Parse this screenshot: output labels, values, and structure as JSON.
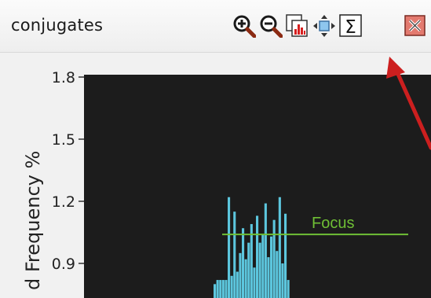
{
  "window": {
    "title": "conjugates"
  },
  "toolbar": {
    "buttons": [
      {
        "icon": "zoom-in-icon"
      },
      {
        "icon": "zoom-out-icon"
      },
      {
        "icon": "histogram-chart-icon"
      },
      {
        "icon": "pan-icon"
      },
      {
        "icon": "sum-icon"
      },
      {
        "icon": "close-icon"
      }
    ],
    "sum_symbol": "Σ"
  },
  "annotation": {
    "arrow_color": "#cc1f1f"
  },
  "chart_data": {
    "type": "bar",
    "ylabel": "d Frequency %",
    "yticks": [
      0.9,
      1.2,
      1.5,
      1.8
    ],
    "ytick_labels": [
      "0.9",
      "1.2",
      "1.5",
      "1.8"
    ],
    "ylim": [
      0.78,
      1.82
    ],
    "background": "#1c1c1c",
    "bar_color": "#5cc6dd",
    "focus": {
      "label": "Focus",
      "value": 1.04,
      "color": "#6fbf35"
    },
    "bars": [
      {
        "v": 0.8
      },
      {
        "v": 0.82
      },
      {
        "v": 0.82
      },
      {
        "v": 0.82
      },
      {
        "v": 0.82
      },
      {
        "v": 1.22
      },
      {
        "v": 0.84
      },
      {
        "v": 1.15
      },
      {
        "v": 0.86
      },
      {
        "v": 0.95
      },
      {
        "v": 1.07
      },
      {
        "v": 0.92
      },
      {
        "v": 1.0
      },
      {
        "v": 1.09
      },
      {
        "v": 0.88
      },
      {
        "v": 1.13
      },
      {
        "v": 1.0
      },
      {
        "v": 1.04
      },
      {
        "v": 1.19
      },
      {
        "v": 0.93
      },
      {
        "v": 1.03
      },
      {
        "v": 1.11
      },
      {
        "v": 0.96
      },
      {
        "v": 1.22
      },
      {
        "v": 0.9
      },
      {
        "v": 1.14
      },
      {
        "v": 0.82
      }
    ]
  }
}
